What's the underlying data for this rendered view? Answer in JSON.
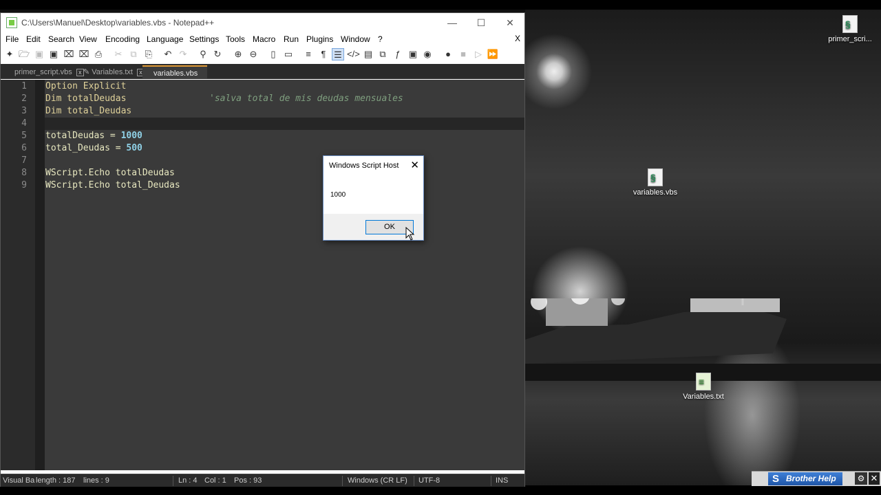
{
  "window": {
    "title": "C:\\Users\\Manuel\\Desktop\\variables.vbs - Notepad++",
    "minimize": "—",
    "maximize": "☐",
    "close": "✕"
  },
  "menu": [
    "File",
    "Edit",
    "Search",
    "View",
    "Encoding",
    "Language",
    "Settings",
    "Tools",
    "Macro",
    "Run",
    "Plugins",
    "Window",
    "?"
  ],
  "menu_close": "X",
  "tabs": [
    {
      "label": "primer_script.vbs",
      "close": "x"
    },
    {
      "label": "Variables.txt",
      "close": "x"
    },
    {
      "label": "variables.vbs",
      "close": "x"
    }
  ],
  "editor": {
    "line_numbers": [
      "1",
      "2",
      "3",
      "4",
      "5",
      "6",
      "7",
      "8",
      "9"
    ],
    "lines": {
      "l1": "Option Explicit",
      "l2_code": "Dim totalDeudas",
      "l2_comment": "'salva total de mis deudas mensuales",
      "l3": "Dim total_Deudas",
      "l5_var": "totalDeudas = ",
      "l5_num": "1000",
      "l6_var": "total_Deudas = ",
      "l6_num": "500",
      "l8": "WScript.Echo totalDeudas",
      "l9": "WScript.Echo total_Deudas"
    }
  },
  "status": {
    "lang": "Visual Ba",
    "length": "length : 187",
    "lines": "lines : 9",
    "ln": "Ln : 4",
    "col": "Col : 1",
    "pos": "Pos : 93",
    "eol": "Windows (CR LF)",
    "encoding": "UTF-8",
    "mode": "INS"
  },
  "dialog": {
    "title": "Windows Script Host",
    "message": "1000",
    "ok": "OK",
    "close": "✕"
  },
  "desktop_icons": [
    {
      "label": "primer_scri...",
      "glyph": "§"
    },
    {
      "label": "variables.vbs",
      "glyph": "§"
    },
    {
      "label": "Variables.txt",
      "glyph": "≡"
    }
  ],
  "brother": {
    "label": "Brother Help",
    "logo": "S",
    "gear": "⚙",
    "close": "✕"
  }
}
